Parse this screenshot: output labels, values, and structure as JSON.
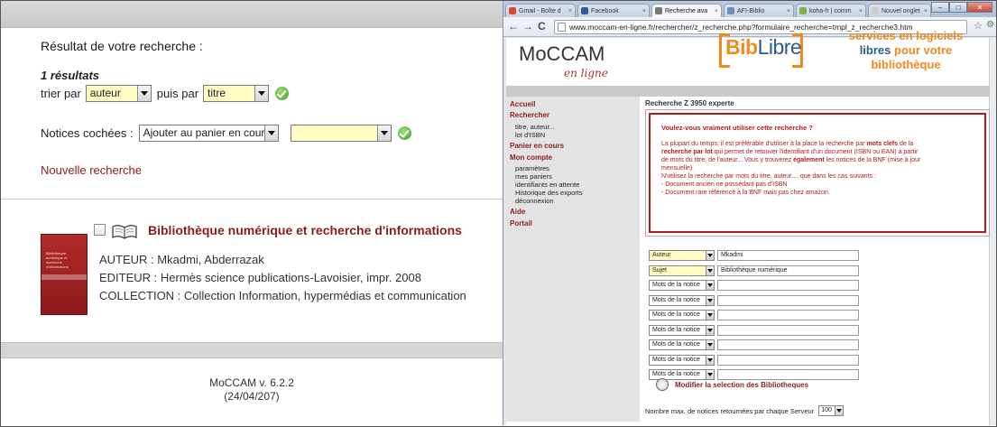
{
  "left": {
    "heading": "Résultat de votre recherche :",
    "count": "1 résultats",
    "sort": {
      "label_before": "trier par",
      "first_value": "auteur",
      "label_middle": "puis par",
      "second_value": "titre"
    },
    "checked": {
      "label": "Notices cochées :",
      "action_value": "Ajouter au panier en cours",
      "target_value": ""
    },
    "new_search": "Nouvelle recherche",
    "result": {
      "title": "Bibliothèque numérique et recherche d'informations",
      "author": "AUTEUR : Mkadmi, Abderrazak",
      "publisher": "EDITEUR : Hermès science publications-Lavoisier, impr. 2008",
      "collection": "COLLECTION : Collection Information, hypermédias et communication",
      "cover_text": "Bibliothèque numérique et recherche d'informations"
    },
    "version": "MoCCAM v. 6.2.2",
    "date": "(24/04/207)"
  },
  "browser": {
    "tabs": [
      {
        "label": "Gmail - Boîte d",
        "color": "#d44b3a",
        "active": false
      },
      {
        "label": "Facebook",
        "color": "#3b5998",
        "active": false
      },
      {
        "label": "Recherche ava",
        "color": "#777777",
        "active": true
      },
      {
        "label": "AFI-Biblio",
        "color": "#6a8fb8",
        "active": false
      },
      {
        "label": "koha-fr | comm",
        "color": "#7fb04a",
        "active": false
      },
      {
        "label": "Nouvel onglet",
        "color": "#cccccc",
        "active": false
      }
    ],
    "url": "www.moccam-en-ligne.fr/rechercher/z_recherche.php?formulaire_recherche=tmpl_z_recherche3.htm",
    "nav": {
      "back": "←",
      "forward": "→",
      "reload": "C"
    },
    "win": {
      "min": "–",
      "max": "□",
      "close": "✕"
    },
    "star": "☆",
    "wrench": "🔧"
  },
  "site": {
    "logo": "MoCCAM",
    "logo_sub": "en ligne",
    "biblibre_bib": "Bib",
    "biblibre_libre": "Libre",
    "slogan_l1": "services en logiciels",
    "slogan_l2a": "libres",
    "slogan_l2b": "pour votre",
    "slogan_l3": "bibliothèque",
    "breadcrumb": "Recherche Z 3950 experte",
    "sidebar": [
      {
        "label": "Accueil",
        "type": "head"
      },
      {
        "label": "Rechercher",
        "type": "head"
      },
      {
        "label": "titre, auteur...",
        "type": "sub"
      },
      {
        "label": "lot d'ISBN",
        "type": "sub"
      },
      {
        "label": "Panier en cours",
        "type": "head"
      },
      {
        "label": "Mon compte",
        "type": "head"
      },
      {
        "label": "paramètres",
        "type": "sub"
      },
      {
        "label": "mes paniers",
        "type": "sub"
      },
      {
        "label": "identifiants en attente",
        "type": "sub"
      },
      {
        "label": "Historique des exports",
        "type": "sub"
      },
      {
        "label": "déconnexion",
        "type": "sub"
      },
      {
        "label": "Aide",
        "type": "head"
      },
      {
        "label": "Portail",
        "type": "head"
      }
    ],
    "alert": {
      "question": "Voulez-vous vraiment utiliser cette recherche ?",
      "p1a": "La plupart du temps, il est préférable d'utiliser à la place la recherche par ",
      "p1b": "mots clefs",
      "p1c": " de la ",
      "p1d": "recherche par lot",
      "p1e": " qui permet de retouver l'identifiant d'un document (ISBN ou EAN) à partir de mots du titre, de l'auteur... Vous y trouverez ",
      "p1f": "également",
      "p1g": " les notices de la BNF (mise à jour mensuelle)",
      "p2": "N'utilisez la recherche par mots du titre, auteur.... que dans les cas suivants :",
      "p3": "- Document ancien ne possédant pas d'ISBN",
      "p4": "- Document rare référencé à la BNF mais pas chez amazon."
    },
    "fields": [
      {
        "select": "Auteur",
        "value": "Mkadmi",
        "yellow": true
      },
      {
        "select": "Sujet",
        "value": "Bibliothèque numérique",
        "yellow": true
      },
      {
        "select": "Mots de la notice",
        "value": "",
        "yellow": false
      },
      {
        "select": "Mots de la notice",
        "value": "",
        "yellow": false
      },
      {
        "select": "Mots de la notice",
        "value": "",
        "yellow": false
      },
      {
        "select": "Mots de la notice",
        "value": "",
        "yellow": false
      },
      {
        "select": "Mots de la notice",
        "value": "",
        "yellow": false
      },
      {
        "select": "Mots de la notice",
        "value": "",
        "yellow": false
      },
      {
        "select": "Mots de la notice",
        "value": "",
        "yellow": false
      }
    ],
    "modify_link": "Modifier la selection des Bibliotheques",
    "max_label": "Nombre max. de notices retournées par chaque Serveur",
    "max_value": "100"
  },
  "colors": {
    "accent_red": "#8c1c1c",
    "alert_red": "#b31b1b",
    "orange": "#f08a1c",
    "blue": "#2e5c8a"
  }
}
